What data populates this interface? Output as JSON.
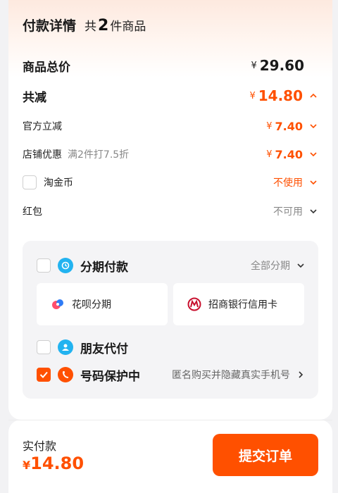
{
  "header": {
    "title": "付款详情",
    "count_prefix": "共",
    "count": "2",
    "count_suffix": "件商品"
  },
  "summary": {
    "total_label": "商品总价",
    "total_currency": "¥",
    "total_amount": "29.60",
    "discount_label": "共减",
    "discount_currency": "¥",
    "discount_amount": "14.80",
    "official_label": "官方立减",
    "official_currency": "¥",
    "official_amount": "7.40",
    "store_label": "店铺优惠",
    "store_desc": "满2件打7.5折",
    "store_currency": "¥",
    "store_amount": "7.40",
    "coin_label": "淘金币",
    "coin_value": "不使用",
    "redpacket_label": "红包",
    "redpacket_value": "不可用"
  },
  "panel": {
    "installment_label": "分期付款",
    "installment_value": "全部分期",
    "option1_label": "花呗分期",
    "option2_label": "招商银行信用卡",
    "friend_label": "朋友代付",
    "privacy_label": "号码保护中",
    "privacy_desc": "匿名购买并隐藏真实手机号"
  },
  "footer": {
    "paid_label": "实付款",
    "paid_currency": "¥",
    "paid_amount": "14.80",
    "submit_label": "提交订单"
  },
  "colors": {
    "accent": "#ff5000",
    "panel_bg": "#f4f4f6",
    "text_gray": "#888888"
  },
  "icons": [
    "chevron-up-icon",
    "chevron-down-icon",
    "chevron-right-icon",
    "installment-icon",
    "huabei-icon",
    "cmb-bank-icon",
    "friend-pay-icon",
    "privacy-shield-icon",
    "checkmark-icon"
  ]
}
